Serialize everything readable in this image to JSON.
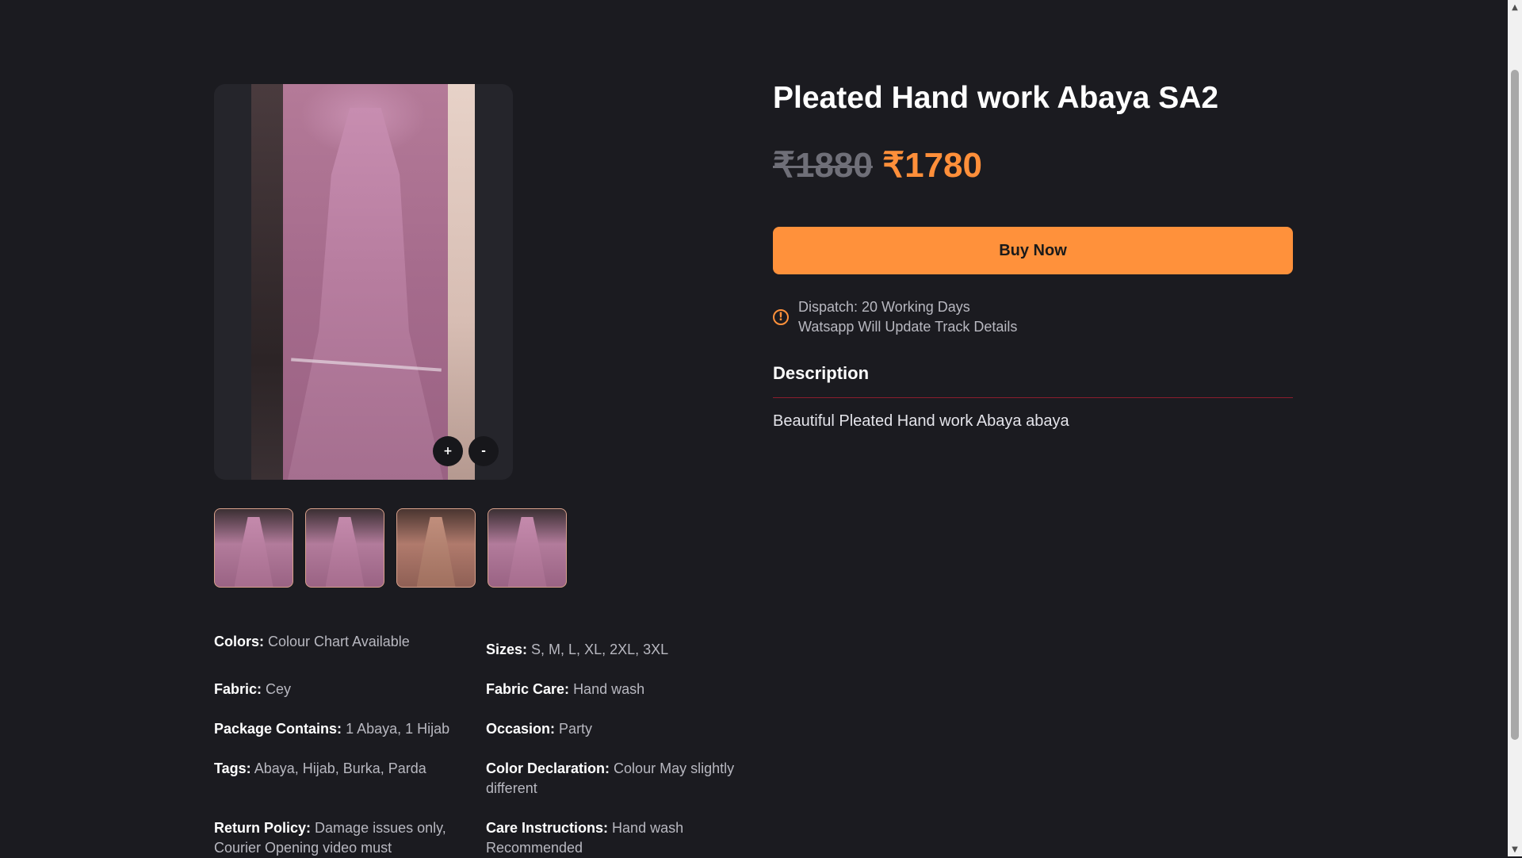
{
  "product": {
    "title": "Pleated Hand work Abaya SA2",
    "old_price": "₹1880",
    "new_price": "₹1780",
    "buy_label": "Buy Now"
  },
  "dispatch": {
    "line1": "Dispatch: 20 Working Days",
    "line2": "Watsapp Will Update Track Details"
  },
  "description": {
    "heading": "Description",
    "text": "Beautiful Pleated Hand work Abaya abaya"
  },
  "gallery": {
    "zoom_in": "+",
    "zoom_out": "-",
    "thumbnail_count": 4
  },
  "attributes": {
    "colors": {
      "label": "Colors:",
      "value": "Colour Chart Available"
    },
    "sizes": {
      "label": "Sizes:",
      "value": "S, M, L, XL, 2XL, 3XL"
    },
    "fabric": {
      "label": "Fabric:",
      "value": "Cey"
    },
    "fabric_care": {
      "label": "Fabric Care:",
      "value": "Hand wash"
    },
    "package": {
      "label": "Package Contains:",
      "value": "1 Abaya, 1 Hijab"
    },
    "occasion": {
      "label": "Occasion:",
      "value": "Party"
    },
    "tags": {
      "label": "Tags:",
      "value": "Abaya, Hijab, Burka, Parda"
    },
    "color_declaration": {
      "label": "Color Declaration:",
      "value": "Colour May slightly different"
    },
    "return_policy": {
      "label": "Return Policy:",
      "value": "Damage issues only, Courier Opening video must"
    },
    "care_instructions": {
      "label": "Care Instructions:",
      "value": "Hand wash Recommended"
    }
  },
  "colors": {
    "background": "#1b1b20",
    "accent": "#ff913b",
    "divider": "#8b1e2e"
  }
}
